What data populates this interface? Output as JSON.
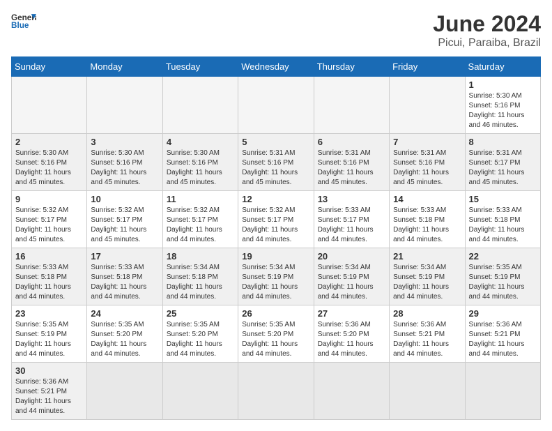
{
  "header": {
    "logo_general": "General",
    "logo_blue": "Blue",
    "title": "June 2024",
    "subtitle": "Picui, Paraiba, Brazil"
  },
  "days_of_week": [
    "Sunday",
    "Monday",
    "Tuesday",
    "Wednesday",
    "Thursday",
    "Friday",
    "Saturday"
  ],
  "weeks": [
    [
      {
        "day": "",
        "sunrise": "",
        "sunset": "",
        "daylight": ""
      },
      {
        "day": "",
        "sunrise": "",
        "sunset": "",
        "daylight": ""
      },
      {
        "day": "",
        "sunrise": "",
        "sunset": "",
        "daylight": ""
      },
      {
        "day": "",
        "sunrise": "",
        "sunset": "",
        "daylight": ""
      },
      {
        "day": "",
        "sunrise": "",
        "sunset": "",
        "daylight": ""
      },
      {
        "day": "",
        "sunrise": "",
        "sunset": "",
        "daylight": ""
      },
      {
        "day": "1",
        "sunrise": "5:30 AM",
        "sunset": "5:16 PM",
        "daylight": "11 hours and 46 minutes."
      }
    ],
    [
      {
        "day": "2",
        "sunrise": "5:30 AM",
        "sunset": "5:16 PM",
        "daylight": "11 hours and 45 minutes."
      },
      {
        "day": "3",
        "sunrise": "5:30 AM",
        "sunset": "5:16 PM",
        "daylight": "11 hours and 45 minutes."
      },
      {
        "day": "4",
        "sunrise": "5:30 AM",
        "sunset": "5:16 PM",
        "daylight": "11 hours and 45 minutes."
      },
      {
        "day": "5",
        "sunrise": "5:31 AM",
        "sunset": "5:16 PM",
        "daylight": "11 hours and 45 minutes."
      },
      {
        "day": "6",
        "sunrise": "5:31 AM",
        "sunset": "5:16 PM",
        "daylight": "11 hours and 45 minutes."
      },
      {
        "day": "7",
        "sunrise": "5:31 AM",
        "sunset": "5:16 PM",
        "daylight": "11 hours and 45 minutes."
      },
      {
        "day": "8",
        "sunrise": "5:31 AM",
        "sunset": "5:17 PM",
        "daylight": "11 hours and 45 minutes."
      }
    ],
    [
      {
        "day": "9",
        "sunrise": "5:32 AM",
        "sunset": "5:17 PM",
        "daylight": "11 hours and 45 minutes."
      },
      {
        "day": "10",
        "sunrise": "5:32 AM",
        "sunset": "5:17 PM",
        "daylight": "11 hours and 45 minutes."
      },
      {
        "day": "11",
        "sunrise": "5:32 AM",
        "sunset": "5:17 PM",
        "daylight": "11 hours and 44 minutes."
      },
      {
        "day": "12",
        "sunrise": "5:32 AM",
        "sunset": "5:17 PM",
        "daylight": "11 hours and 44 minutes."
      },
      {
        "day": "13",
        "sunrise": "5:33 AM",
        "sunset": "5:17 PM",
        "daylight": "11 hours and 44 minutes."
      },
      {
        "day": "14",
        "sunrise": "5:33 AM",
        "sunset": "5:18 PM",
        "daylight": "11 hours and 44 minutes."
      },
      {
        "day": "15",
        "sunrise": "5:33 AM",
        "sunset": "5:18 PM",
        "daylight": "11 hours and 44 minutes."
      }
    ],
    [
      {
        "day": "16",
        "sunrise": "5:33 AM",
        "sunset": "5:18 PM",
        "daylight": "11 hours and 44 minutes."
      },
      {
        "day": "17",
        "sunrise": "5:33 AM",
        "sunset": "5:18 PM",
        "daylight": "11 hours and 44 minutes."
      },
      {
        "day": "18",
        "sunrise": "5:34 AM",
        "sunset": "5:18 PM",
        "daylight": "11 hours and 44 minutes."
      },
      {
        "day": "19",
        "sunrise": "5:34 AM",
        "sunset": "5:19 PM",
        "daylight": "11 hours and 44 minutes."
      },
      {
        "day": "20",
        "sunrise": "5:34 AM",
        "sunset": "5:19 PM",
        "daylight": "11 hours and 44 minutes."
      },
      {
        "day": "21",
        "sunrise": "5:34 AM",
        "sunset": "5:19 PM",
        "daylight": "11 hours and 44 minutes."
      },
      {
        "day": "22",
        "sunrise": "5:35 AM",
        "sunset": "5:19 PM",
        "daylight": "11 hours and 44 minutes."
      }
    ],
    [
      {
        "day": "23",
        "sunrise": "5:35 AM",
        "sunset": "5:19 PM",
        "daylight": "11 hours and 44 minutes."
      },
      {
        "day": "24",
        "sunrise": "5:35 AM",
        "sunset": "5:20 PM",
        "daylight": "11 hours and 44 minutes."
      },
      {
        "day": "25",
        "sunrise": "5:35 AM",
        "sunset": "5:20 PM",
        "daylight": "11 hours and 44 minutes."
      },
      {
        "day": "26",
        "sunrise": "5:35 AM",
        "sunset": "5:20 PM",
        "daylight": "11 hours and 44 minutes."
      },
      {
        "day": "27",
        "sunrise": "5:36 AM",
        "sunset": "5:20 PM",
        "daylight": "11 hours and 44 minutes."
      },
      {
        "day": "28",
        "sunrise": "5:36 AM",
        "sunset": "5:21 PM",
        "daylight": "11 hours and 44 minutes."
      },
      {
        "day": "29",
        "sunrise": "5:36 AM",
        "sunset": "5:21 PM",
        "daylight": "11 hours and 44 minutes."
      }
    ],
    [
      {
        "day": "30",
        "sunrise": "5:36 AM",
        "sunset": "5:21 PM",
        "daylight": "11 hours and 44 minutes."
      },
      {
        "day": "",
        "sunrise": "",
        "sunset": "",
        "daylight": ""
      },
      {
        "day": "",
        "sunrise": "",
        "sunset": "",
        "daylight": ""
      },
      {
        "day": "",
        "sunrise": "",
        "sunset": "",
        "daylight": ""
      },
      {
        "day": "",
        "sunrise": "",
        "sunset": "",
        "daylight": ""
      },
      {
        "day": "",
        "sunrise": "",
        "sunset": "",
        "daylight": ""
      },
      {
        "day": "",
        "sunrise": "",
        "sunset": "",
        "daylight": ""
      }
    ]
  ],
  "labels": {
    "sunrise": "Sunrise:",
    "sunset": "Sunset:",
    "daylight": "Daylight:"
  }
}
